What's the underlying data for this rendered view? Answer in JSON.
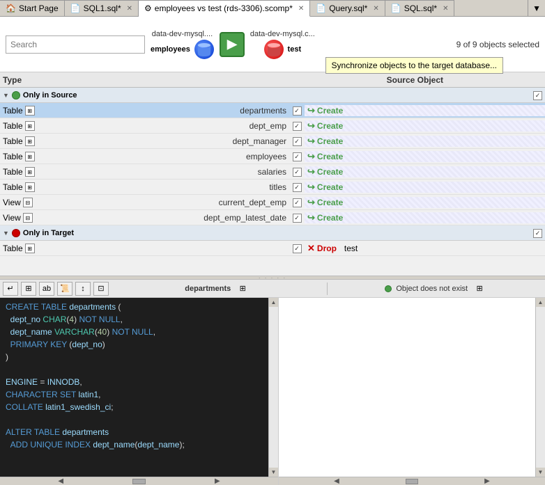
{
  "tabs": [
    {
      "id": "start",
      "label": "Start Page",
      "icon": "🏠",
      "active": false,
      "closable": false
    },
    {
      "id": "sql1",
      "label": "SQL1.sql*",
      "icon": "📄",
      "active": false,
      "closable": true
    },
    {
      "id": "scomp",
      "label": "employees vs test (rds-3306).scomp*",
      "icon": "⚙",
      "active": true,
      "closable": true
    },
    {
      "id": "query",
      "label": "Query.sql*",
      "icon": "📄",
      "active": false,
      "closable": true
    },
    {
      "id": "sqlmain",
      "label": "SQL.sql*",
      "icon": "📄",
      "active": false,
      "closable": true
    }
  ],
  "header": {
    "search_placeholder": "Search",
    "source_db": "data-dev-mysql....",
    "source_name": "employees",
    "target_db": "data-dev-mysql.c...",
    "target_name": "test",
    "objects_selected": "9 of 9 objects selected",
    "tooltip": "Synchronize objects to the target database..."
  },
  "columns": {
    "type": "Type",
    "source_object": "Source Object",
    "action": ""
  },
  "sections": [
    {
      "id": "only_in_source",
      "label": "Only in Source",
      "dot_color": "green",
      "rows": [
        {
          "type": "Table",
          "source": "departments",
          "checked": true,
          "action": "Create",
          "striped": true,
          "selected": true
        },
        {
          "type": "Table",
          "source": "dept_emp",
          "checked": true,
          "action": "Create",
          "striped": true
        },
        {
          "type": "Table",
          "source": "dept_manager",
          "checked": true,
          "action": "Create",
          "striped": true
        },
        {
          "type": "Table",
          "source": "employees",
          "checked": true,
          "action": "Create",
          "striped": true
        },
        {
          "type": "Table",
          "source": "salaries",
          "checked": true,
          "action": "Create",
          "striped": true
        },
        {
          "type": "Table",
          "source": "titles",
          "checked": true,
          "action": "Create",
          "striped": true
        },
        {
          "type": "View",
          "source": "current_dept_emp",
          "checked": true,
          "action": "Create",
          "striped": true
        },
        {
          "type": "View",
          "source": "dept_emp_latest_date",
          "checked": true,
          "action": "Create",
          "striped": true
        }
      ]
    },
    {
      "id": "only_in_target",
      "label": "Only in Target",
      "dot_color": "red",
      "rows": [
        {
          "type": "Table",
          "source": "",
          "checked": true,
          "action": "Drop",
          "target": "test",
          "striped": false
        }
      ]
    }
  ],
  "bottom_panel": {
    "left_title": "departments",
    "right_title": "Object does not exist",
    "code": [
      {
        "indent": 0,
        "tokens": [
          {
            "type": "kw",
            "text": "CREATE"
          },
          {
            "type": "plain",
            "text": " "
          },
          {
            "type": "kw",
            "text": "TABLE"
          },
          {
            "type": "plain",
            "text": " "
          },
          {
            "type": "id",
            "text": "departments"
          },
          {
            "type": "plain",
            "text": " ("
          }
        ]
      },
      {
        "indent": 2,
        "tokens": [
          {
            "type": "id",
            "text": "dept_no"
          },
          {
            "type": "plain",
            "text": " "
          },
          {
            "type": "type-kw",
            "text": "CHAR"
          },
          {
            "type": "plain",
            "text": "("
          },
          {
            "type": "num",
            "text": "4"
          },
          {
            "type": "plain",
            "text": ") "
          },
          {
            "type": "kw",
            "text": "NOT NULL"
          },
          {
            "type": "plain",
            "text": ","
          }
        ]
      },
      {
        "indent": 2,
        "tokens": [
          {
            "type": "id",
            "text": "dept_name"
          },
          {
            "type": "plain",
            "text": " "
          },
          {
            "type": "type-kw",
            "text": "VARCHAR"
          },
          {
            "type": "plain",
            "text": "("
          },
          {
            "type": "num",
            "text": "40"
          },
          {
            "type": "plain",
            "text": ") "
          },
          {
            "type": "kw",
            "text": "NOT NULL"
          },
          {
            "type": "plain",
            "text": ","
          }
        ]
      },
      {
        "indent": 2,
        "tokens": [
          {
            "type": "kw",
            "text": "PRIMARY KEY"
          },
          {
            "type": "plain",
            "text": " ("
          },
          {
            "type": "id",
            "text": "dept_no"
          },
          {
            "type": "plain",
            "text": ")"
          }
        ]
      },
      {
        "indent": 0,
        "tokens": [
          {
            "type": "plain",
            "text": ")"
          }
        ]
      },
      {
        "indent": 0,
        "tokens": []
      },
      {
        "indent": 0,
        "tokens": [
          {
            "type": "id",
            "text": "ENGINE"
          },
          {
            "type": "plain",
            "text": " = "
          },
          {
            "type": "id",
            "text": "INNODB"
          },
          {
            "type": "plain",
            "text": ","
          }
        ]
      },
      {
        "indent": 0,
        "tokens": [
          {
            "type": "kw",
            "text": "CHARACTER SET"
          },
          {
            "type": "plain",
            "text": " "
          },
          {
            "type": "id",
            "text": "latin1"
          },
          {
            "type": "plain",
            "text": ","
          }
        ]
      },
      {
        "indent": 0,
        "tokens": [
          {
            "type": "kw",
            "text": "COLLATE"
          },
          {
            "type": "plain",
            "text": " "
          },
          {
            "type": "id",
            "text": "latin1_swedish_ci"
          },
          {
            "type": "plain",
            "text": ";"
          }
        ]
      },
      {
        "indent": 0,
        "tokens": []
      },
      {
        "indent": 0,
        "tokens": [
          {
            "type": "kw",
            "text": "ALTER TABLE"
          },
          {
            "type": "plain",
            "text": " "
          },
          {
            "type": "id",
            "text": "departments"
          }
        ]
      },
      {
        "indent": 2,
        "tokens": [
          {
            "type": "kw",
            "text": "ADD UNIQUE INDEX"
          },
          {
            "type": "plain",
            "text": " "
          },
          {
            "type": "id",
            "text": "dept_name"
          },
          {
            "type": "plain",
            "text": "("
          },
          {
            "type": "id",
            "text": "dept_name"
          },
          {
            "type": "plain",
            "text": ");"
          }
        ]
      }
    ],
    "toolbar_buttons": [
      "wrap",
      "grid",
      "ab",
      "script",
      "sort",
      "expand"
    ]
  }
}
